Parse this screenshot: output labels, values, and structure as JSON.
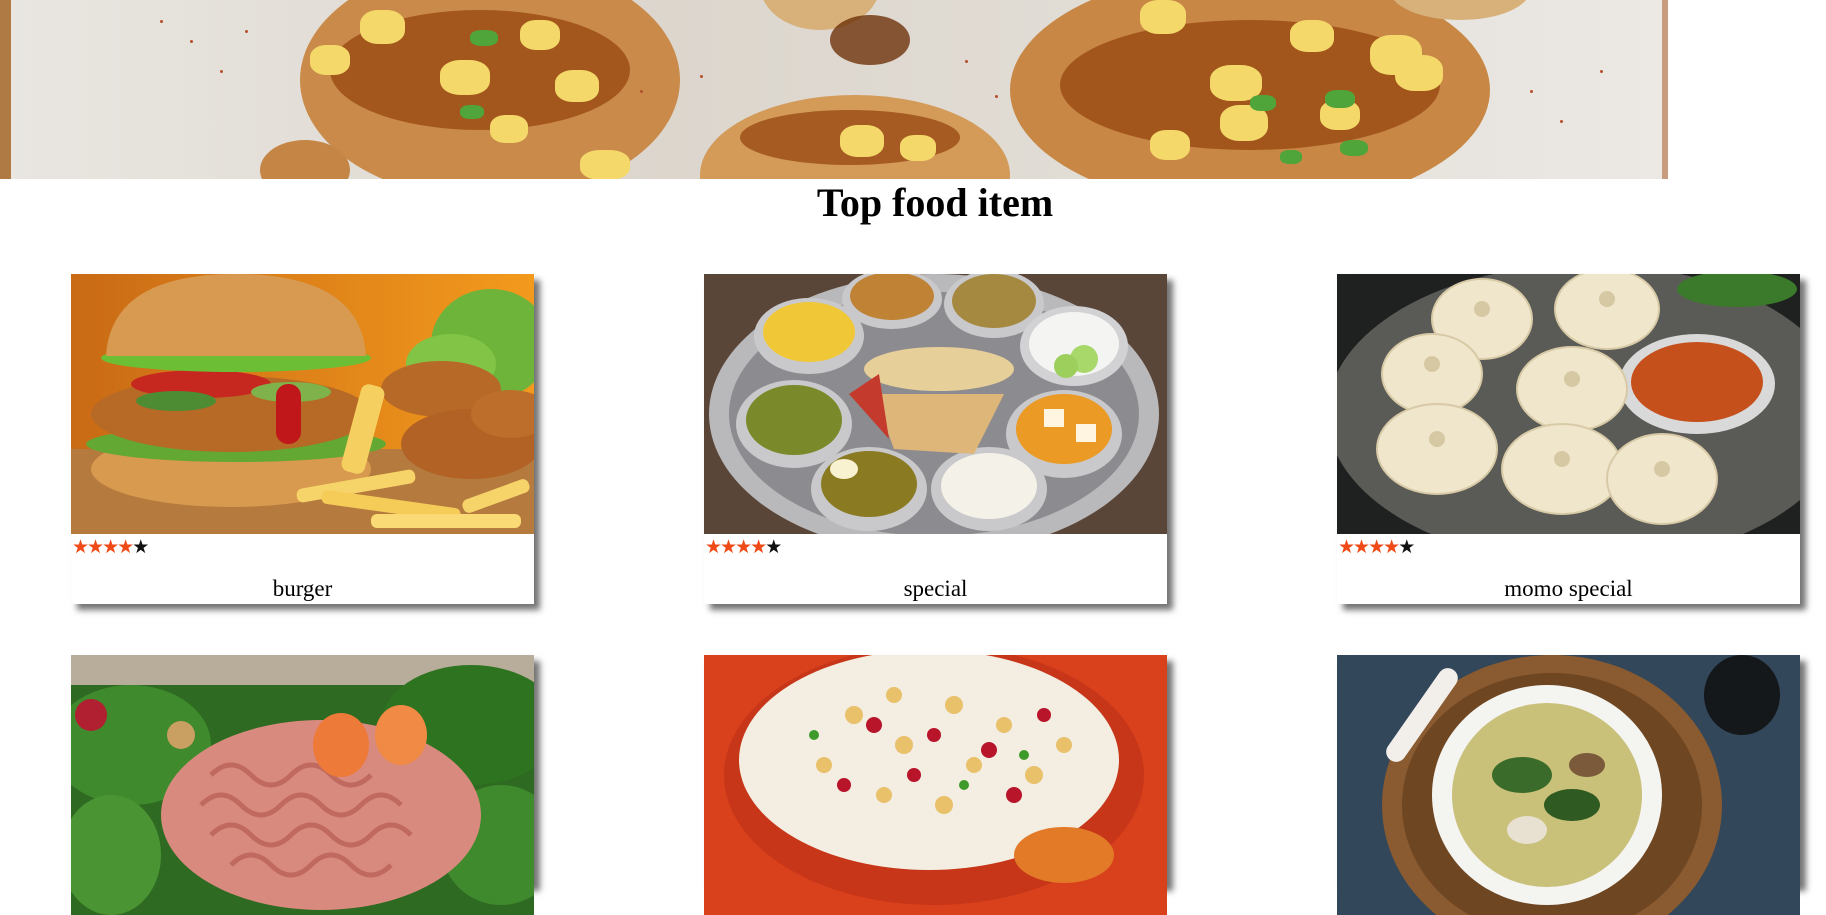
{
  "hero": {
    "image": "dahi-puri-chaat-banner"
  },
  "section_title": "Top food item",
  "cards": [
    {
      "name": "burger",
      "rating": 4,
      "max_rating": 5,
      "image": "burger-with-fries"
    },
    {
      "name": "special",
      "rating": 4,
      "max_rating": 5,
      "image": "thali-platter"
    },
    {
      "name": "momo special",
      "rating": 4,
      "max_rating": 5,
      "image": "momos-with-chutney"
    },
    {
      "name": "",
      "rating": null,
      "image": "pasta-salad"
    },
    {
      "name": "",
      "rating": null,
      "image": "chaat-bowl"
    },
    {
      "name": "",
      "rating": null,
      "image": "soup-bowl"
    }
  ],
  "colors": {
    "star_filled": "#ef4a18",
    "star_empty": "#111111",
    "card_shadow": "#555555"
  },
  "icons": {
    "star": "star-icon"
  }
}
